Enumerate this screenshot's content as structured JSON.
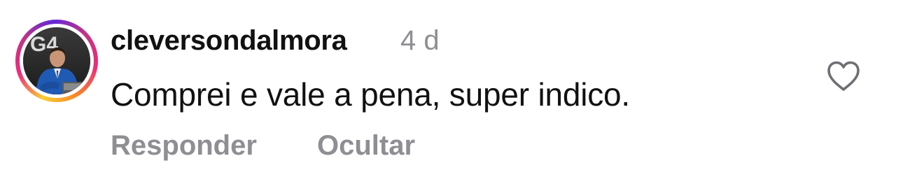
{
  "comment": {
    "author": "cleversondalmora",
    "age": "4 d",
    "text": "Comprei e vale a pena, super indico.",
    "avatar_overlay_text": "G4",
    "actions": {
      "reply_label": "Responder",
      "hide_label": "Ocultar"
    },
    "like_icon": "heart-outline-icon"
  },
  "colors": {
    "text_primary": "#111111",
    "text_secondary": "#8e8e93",
    "story_ring": [
      "#f9ce34",
      "#ee2a7b",
      "#6228d7"
    ]
  }
}
